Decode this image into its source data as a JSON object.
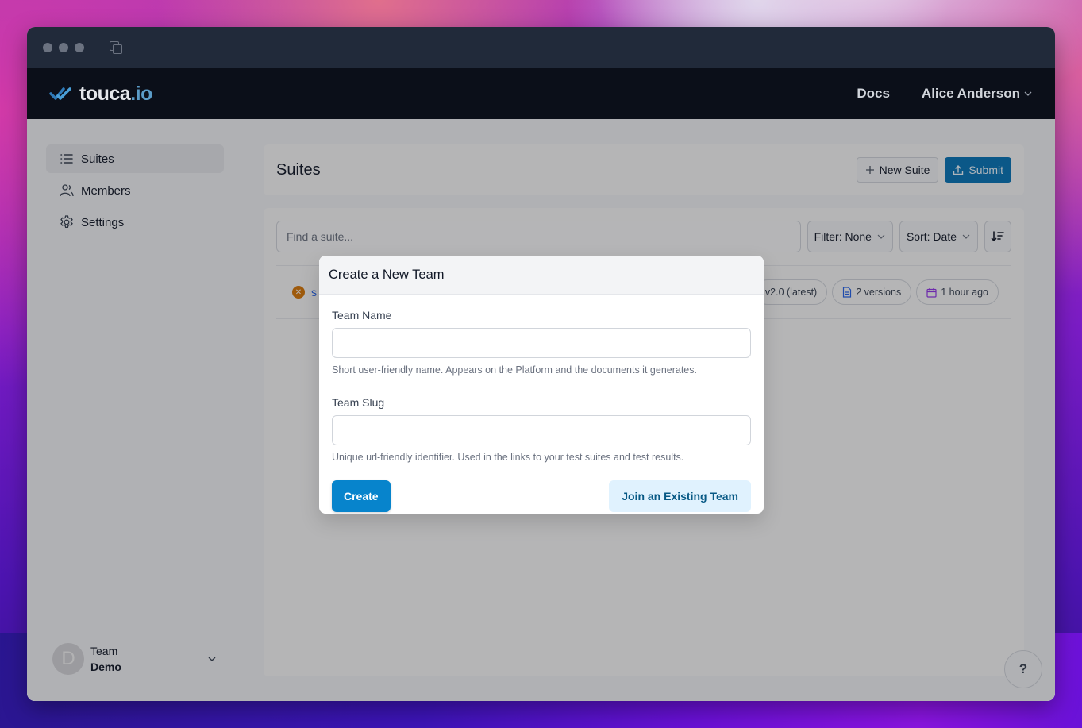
{
  "window": {
    "traffic_lights": [
      "close",
      "minimize",
      "zoom"
    ],
    "tab_icon": "copy-windows-icon"
  },
  "navbar": {
    "logo": {
      "text_main": "touca",
      "text_suffix": ".io",
      "icon": "double-check-icon"
    },
    "docs_label": "Docs",
    "user_name": "Alice Anderson"
  },
  "sidebar": {
    "items": [
      {
        "label": "Suites",
        "icon": "list-icon",
        "active": true
      },
      {
        "label": "Members",
        "icon": "users-icon",
        "active": false
      },
      {
        "label": "Settings",
        "icon": "gear-icon",
        "active": false
      }
    ],
    "team": {
      "avatar_letter": "D",
      "caption": "Team",
      "name": "Demo"
    }
  },
  "header": {
    "title": "Suites",
    "new_suite_label": "New Suite",
    "submit_label": "Submit"
  },
  "toolbar": {
    "search_placeholder": "Find a suite...",
    "search_value": "",
    "filter_label": "Filter: None",
    "sort_label": "Sort: Date",
    "sort_direction_icon": "sort-descending-icon"
  },
  "suites": [
    {
      "status": "failed",
      "name": "s",
      "version": "v2.0 (latest)",
      "versions_count": "2 versions",
      "updated": "1 hour ago"
    }
  ],
  "help_label": "?",
  "modal": {
    "title": "Create a New Team",
    "fields": [
      {
        "label": "Team Name",
        "value": "",
        "help": "Short user-friendly name. Appears on the Platform and the documents it generates."
      },
      {
        "label": "Team Slug",
        "value": "",
        "help": "Unique url-friendly identifier. Used in the links to your test suites and test results."
      }
    ],
    "create_label": "Create",
    "join_label": "Join an Existing Team"
  },
  "colors": {
    "primary": "#0784cc",
    "submit": "#0774b8",
    "navbar": "#0b0f19",
    "titlebar": "#212a3a",
    "status_failed": "#d97706"
  }
}
